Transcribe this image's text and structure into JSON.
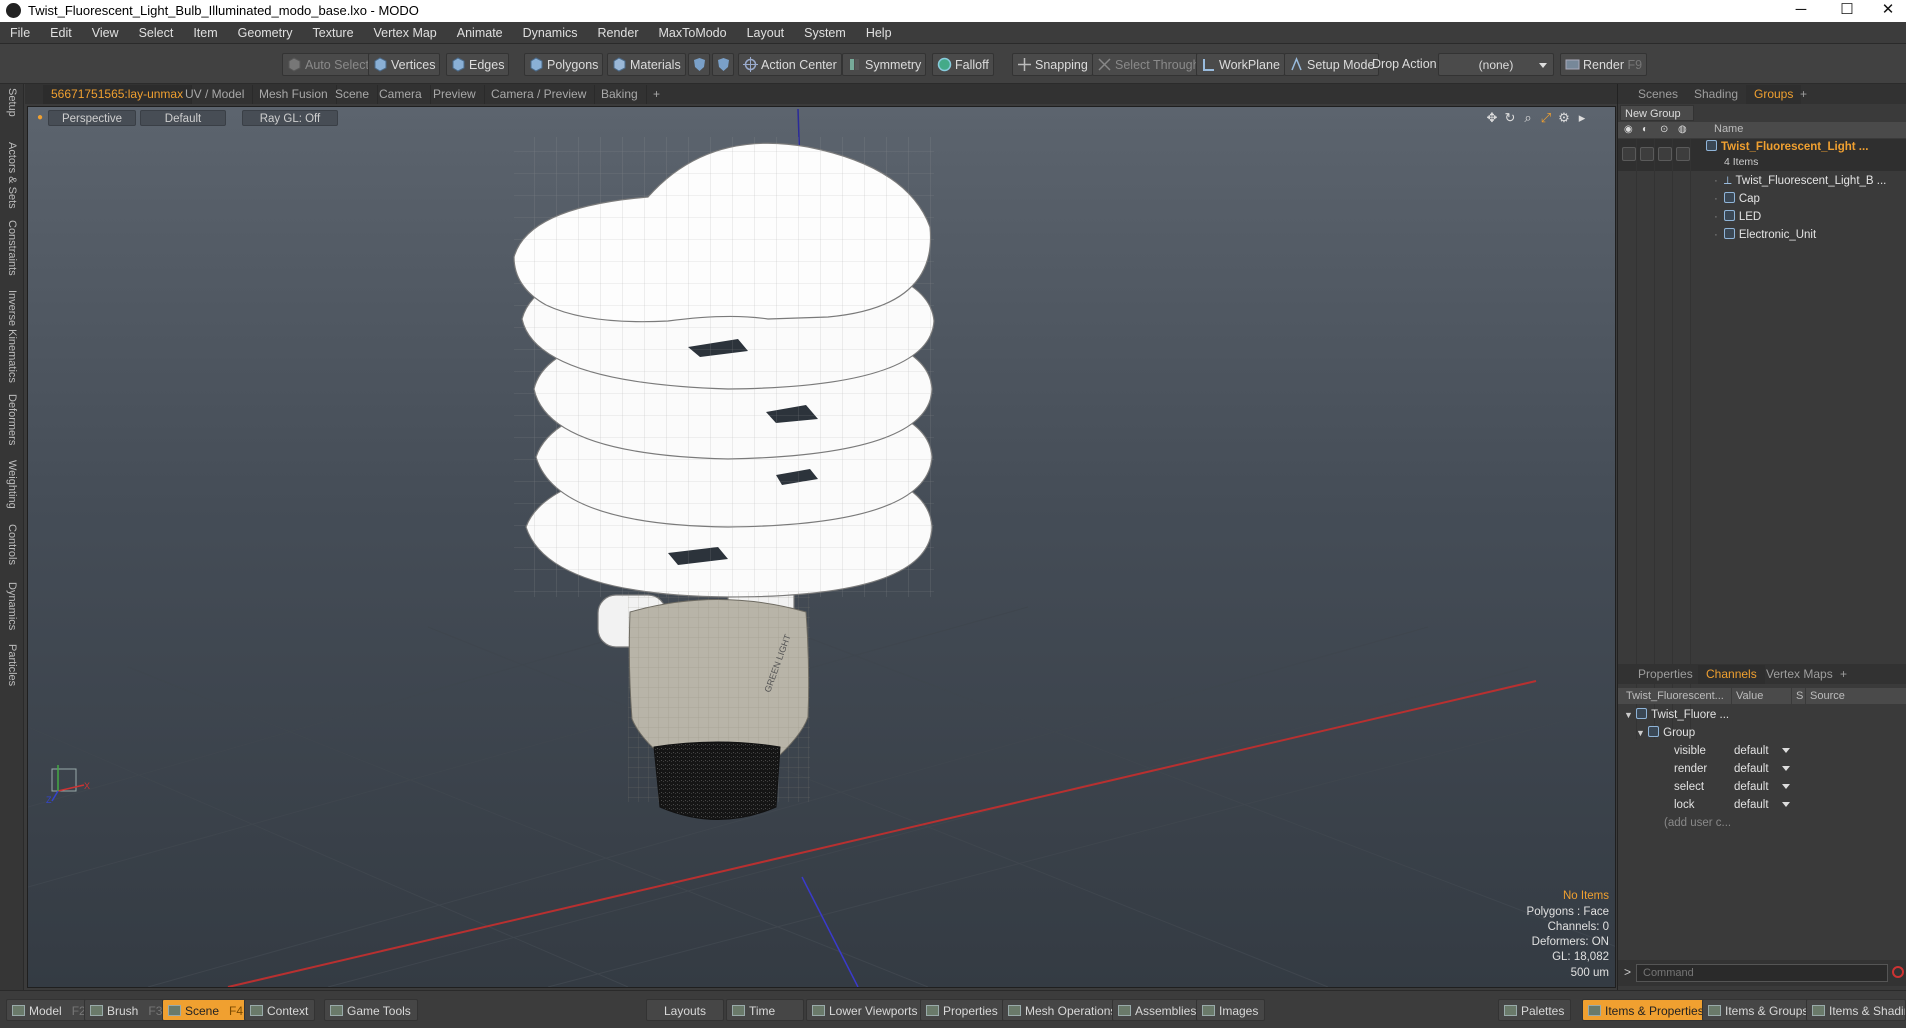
{
  "window": {
    "title": "Twist_Fluorescent_Light_Bulb_Illuminated_modo_base.lxo - MODO",
    "minimize": "─",
    "maximize": "☐",
    "close": "✕"
  },
  "menu": [
    "File",
    "Edit",
    "View",
    "Select",
    "Item",
    "Geometry",
    "Texture",
    "Vertex Map",
    "Animate",
    "Dynamics",
    "Render",
    "MaxToModo",
    "Layout",
    "System",
    "Help"
  ],
  "toolbar": {
    "auto_select": "Auto Select",
    "vertices": "Vertices",
    "edges": "Edges",
    "polygons": "Polygons",
    "materials": "Materials",
    "action_center": "Action Center",
    "symmetry": "Symmetry",
    "falloff": "Falloff",
    "snapping": "Snapping",
    "select_through": "Select Through",
    "workplane": "WorkPlane",
    "setup_mode": "Setup Mode",
    "drop_action": "Drop Action",
    "drop_action_value": "(none)",
    "render": "Render",
    "render_key": "F9"
  },
  "left_tabs": [
    "Setup",
    "Actors & Sets",
    "Constraints",
    "Inverse Kinematics",
    "Deformers",
    "Weighting",
    "Controls",
    "Dynamics",
    "Particles"
  ],
  "viewport_tabs": [
    "56671751565:lay-unmax",
    "UV / Model",
    "Mesh Fusion",
    "Scene",
    "Camera",
    "Preview",
    "Camera / Preview",
    "Baking",
    "+"
  ],
  "viewport": {
    "perspective": "Perspective",
    "shading": "Default",
    "raygl": "Ray GL: Off",
    "stats": {
      "no_items": "No Items",
      "polygons": "Polygons : Face",
      "channels": "Channels: 0",
      "deformers": "Deformers: ON",
      "gl": "GL: 18,082",
      "size": "500 um"
    },
    "axis": {
      "x": "X",
      "y": "Y",
      "z": "Z"
    },
    "label_text": "GREEN LIGHT"
  },
  "groups_panel": {
    "tabs": [
      "Scenes",
      "Shading",
      "Groups",
      "+"
    ],
    "new_group": "New Group",
    "name_col": "Name",
    "root": {
      "name": "Twist_Fluorescent_Light ...",
      "count": "4 Items"
    },
    "items": [
      "Twist_Fluorescent_Light_B ...",
      "Cap",
      "LED",
      "Electronic_Unit"
    ]
  },
  "channels_panel": {
    "tabs": [
      "Properties",
      "Channels",
      "Vertex Maps",
      "+"
    ],
    "headers": [
      "Twist_Fluorescent...",
      "Value",
      "S",
      "Source"
    ],
    "tree_root": "Twist_Fluore ...",
    "group": "Group",
    "rows": [
      {
        "name": "visible",
        "value": "default"
      },
      {
        "name": "render",
        "value": "default"
      },
      {
        "name": "select",
        "value": "default"
      },
      {
        "name": "lock",
        "value": "default"
      }
    ],
    "add_user": "(add user c..."
  },
  "command": {
    "prompt": ">",
    "placeholder": "Command"
  },
  "bottombar": {
    "model": "Model",
    "model_key": "F2",
    "brush": "Brush",
    "brush_key": "F3",
    "scene": "Scene",
    "scene_key": "F4",
    "context": "Context",
    "game_tools": "Game Tools",
    "layouts": "Layouts",
    "time": "Time",
    "lower_viewports": "Lower Viewports",
    "properties": "Properties",
    "mesh_operations": "Mesh Operations",
    "assemblies": "Assemblies",
    "images": "Images",
    "palettes": "Palettes",
    "items_properties": "Items & Properties",
    "items_groups": "Items & Groups",
    "items_shading": "Items & Shading"
  },
  "colors": {
    "accent": "#f0a030",
    "x_axis": "#d42a2a",
    "y_axis": "#3838c8"
  }
}
